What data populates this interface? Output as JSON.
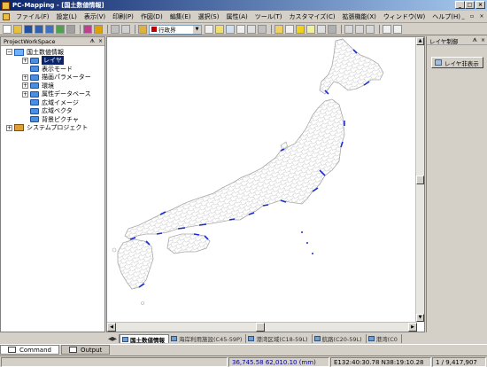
{
  "window": {
    "app_name": "PC-Mapping",
    "document": "[国土数値情報]",
    "title_separator": " - "
  },
  "menu": [
    "ファイル(F)",
    "設定(L)",
    "表示(V)",
    "印刷(P)",
    "作図(D)",
    "編集(E)",
    "選択(S)",
    "属性(A)",
    "ツール(T)",
    "カスタマイズ(C)",
    "拡張機能(X)",
    "ウィンドウ(W)",
    "ヘルプ(H)"
  ],
  "toolbar": {
    "layer_selector_value": "行政界"
  },
  "workspace": {
    "title": "ProjectWorkSpace",
    "tree": [
      {
        "label": "国土数値情報",
        "level": 0,
        "icon": "database-icon",
        "expander": "−"
      },
      {
        "label": "レイヤ",
        "level": 1,
        "icon": "folder-icon",
        "expander": "+",
        "selected": true
      },
      {
        "label": "表示モード",
        "level": 1,
        "icon": "folder-icon",
        "expander": ""
      },
      {
        "label": "描画パラメーター",
        "level": 1,
        "icon": "folder-icon",
        "expander": "+"
      },
      {
        "label": "環境",
        "level": 1,
        "icon": "folder-icon",
        "expander": "+"
      },
      {
        "label": "属性データベース",
        "level": 1,
        "icon": "folder-icon",
        "expander": "+"
      },
      {
        "label": "広域イメージ",
        "level": 1,
        "icon": "folder-icon",
        "expander": ""
      },
      {
        "label": "広域ベクタ",
        "level": 1,
        "icon": "folder-icon",
        "expander": ""
      },
      {
        "label": "背景ピクチャ",
        "level": 1,
        "icon": "folder-icon",
        "expander": ""
      },
      {
        "label": "システムプロジェクト",
        "level": 0,
        "icon": "system-project-icon",
        "expander": "+"
      }
    ]
  },
  "layer_control": {
    "title": "レイヤ制御",
    "hide_button": "レイヤ非表示"
  },
  "doc_tabs": [
    "国土数値情報",
    "海岸利用施設(C45-59P)",
    "港湾区域(C18-59L)",
    "航路(C20-59L)",
    "港湾(C0"
  ],
  "bottom_tabs": [
    "Command",
    "Output"
  ],
  "status": {
    "coords_mm": "36,745.58 62,010.10 (mm)",
    "latlon": "E132:40:30.78 N38:19:10.28",
    "scale": "1 / 9,417,907"
  },
  "colors": {
    "title_start": "#0a246a",
    "title_end": "#a6caf0",
    "coast_highlight": "#1a2bd6",
    "boundary_lines": "#a8a8a8"
  }
}
